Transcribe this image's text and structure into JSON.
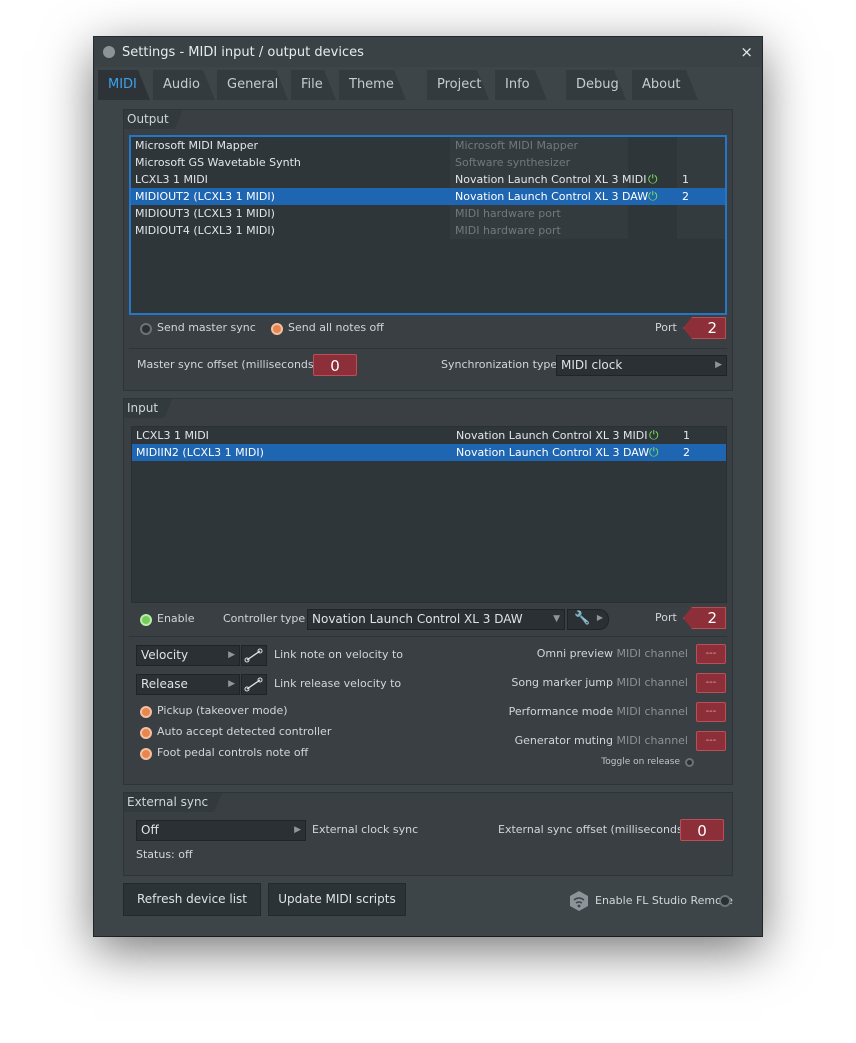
{
  "window": {
    "title": "Settings - MIDI input / output devices",
    "close_icon": "×"
  },
  "tabs": [
    {
      "label": "MIDI",
      "active": true
    },
    {
      "label": "Audio"
    },
    {
      "label": "General"
    },
    {
      "label": "File"
    },
    {
      "label": "Theme"
    },
    {
      "label": "Project"
    },
    {
      "label": "Info"
    },
    {
      "label": "Debug"
    },
    {
      "label": "About"
    }
  ],
  "output": {
    "title": "Output",
    "devices": [
      {
        "name": "Microsoft MIDI Mapper",
        "desc": "Microsoft MIDI Mapper",
        "enabled": false,
        "port": ""
      },
      {
        "name": "Microsoft GS Wavetable Synth",
        "desc": "Software synthesizer",
        "enabled": false,
        "port": ""
      },
      {
        "name": "LCXL3 1 MIDI",
        "desc": "Novation Launch Control XL 3 MIDI",
        "enabled": true,
        "port": "1"
      },
      {
        "name": "MIDIOUT2 (LCXL3 1 MIDI)",
        "desc": "Novation Launch Control XL 3 DAW",
        "enabled": true,
        "port": "2",
        "selected": true
      },
      {
        "name": "MIDIOUT3 (LCXL3 1 MIDI)",
        "desc": "MIDI hardware port",
        "enabled": false,
        "port": ""
      },
      {
        "name": "MIDIOUT4 (LCXL3 1 MIDI)",
        "desc": "MIDI hardware port",
        "enabled": false,
        "port": ""
      }
    ],
    "send_master_sync": "Send master sync",
    "send_all_notes_off": "Send all notes off",
    "port_label": "Port",
    "port_value": "2",
    "master_sync_offset_label": "Master sync offset (milliseconds)",
    "master_sync_offset_value": "0",
    "sync_type_label": "Synchronization type",
    "sync_type_value": "MIDI clock"
  },
  "input": {
    "title": "Input",
    "devices": [
      {
        "name": "LCXL3 1 MIDI",
        "desc": "Novation Launch Control XL 3 MIDI",
        "enabled": true,
        "port": "1"
      },
      {
        "name": "MIDIIN2 (LCXL3 1 MIDI)",
        "desc": "Novation Launch Control XL 3 DAW",
        "enabled": true,
        "port": "2",
        "selected": true
      }
    ],
    "enable_label": "Enable",
    "controller_type_label": "Controller type",
    "controller_type_value": "Novation Launch Control XL 3 DAW",
    "port_label": "Port",
    "port_value": "2",
    "velocity_value": "Velocity",
    "link_velocity_label": "Link note on velocity to",
    "release_value": "Release",
    "link_release_label": "Link release velocity to",
    "options": [
      "Pickup (takeover mode)",
      "Auto accept detected controller",
      "Foot pedal controls note off"
    ],
    "channels": [
      {
        "label": "Omni preview",
        "suffix": "MIDI channel",
        "value": "---"
      },
      {
        "label": "Song marker jump",
        "suffix": "MIDI channel",
        "value": "---"
      },
      {
        "label": "Performance mode",
        "suffix": "MIDI channel",
        "value": "---"
      },
      {
        "label": "Generator muting",
        "suffix": "MIDI channel",
        "value": "---"
      }
    ],
    "toggle_on_release": "Toggle on release"
  },
  "external_sync": {
    "title": "External sync",
    "clock_value": "Off",
    "clock_label": "External clock sync",
    "offset_label": "External sync offset (milliseconds)",
    "offset_value": "0",
    "status": "Status: off"
  },
  "footer": {
    "refresh_label": "Refresh device list",
    "update_label": "Update MIDI scripts",
    "remote_label": "Enable FL Studio Remote"
  },
  "colors": {
    "selection": "#1e65b2",
    "accent": "#3ea2ea",
    "power": "#7be05b",
    "value_box": "#8c2f38"
  }
}
